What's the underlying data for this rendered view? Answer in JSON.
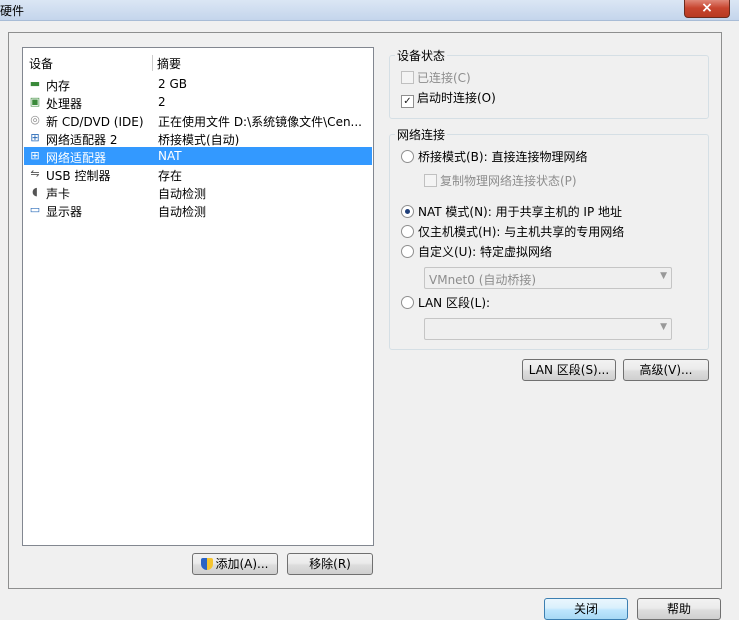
{
  "window": {
    "title": "硬件",
    "close": "×"
  },
  "device_list": {
    "headers": {
      "device": "设备",
      "summary": "摘要"
    },
    "rows": [
      {
        "name": "内存",
        "summary": "2 GB",
        "icon": "memory-icon"
      },
      {
        "name": "处理器",
        "summary": "2",
        "icon": "processor-icon"
      },
      {
        "name": "新 CD/DVD (IDE)",
        "summary": "正在使用文件 D:\\系统镜像文件\\Cen...",
        "icon": "cd-dvd-icon"
      },
      {
        "name": "网络适配器 2",
        "summary": "桥接模式(自动)",
        "icon": "network-adapter-icon"
      },
      {
        "name": "网络适配器",
        "summary": "NAT",
        "icon": "network-adapter-icon"
      },
      {
        "name": "USB 控制器",
        "summary": "存在",
        "icon": "usb-icon"
      },
      {
        "name": "声卡",
        "summary": "自动检测",
        "icon": "sound-card-icon"
      },
      {
        "name": "显示器",
        "summary": "自动检测",
        "icon": "display-icon"
      }
    ],
    "selected": "网络适配器"
  },
  "buttons": {
    "add": "添加(A)...",
    "remove": "移除(R)",
    "lan_segments": "LAN 区段(S)...",
    "advanced": "高级(V)...",
    "close": "关闭",
    "help": "帮助"
  },
  "device_status": {
    "title": "设备状态",
    "connected": {
      "label": "已连接(C)",
      "checked": false,
      "enabled": false
    },
    "connect_at_power_on": {
      "label": "启动时连接(O)",
      "checked": true,
      "enabled": true
    }
  },
  "network_connection": {
    "title": "网络连接",
    "bridged": "桥接模式(B): 直接连接物理网络",
    "replicate": "复制物理网络连接状态(P)",
    "nat": "NAT 模式(N): 用于共享主机的 IP 地址",
    "host_only": "仅主机模式(H): 与主机共享的专用网络",
    "custom": "自定义(U): 特定虚拟网络",
    "custom_value": "VMnet0 (自动桥接)",
    "lan_segment": "LAN 区段(L):",
    "lan_segment_value": "",
    "selected": "nat"
  }
}
